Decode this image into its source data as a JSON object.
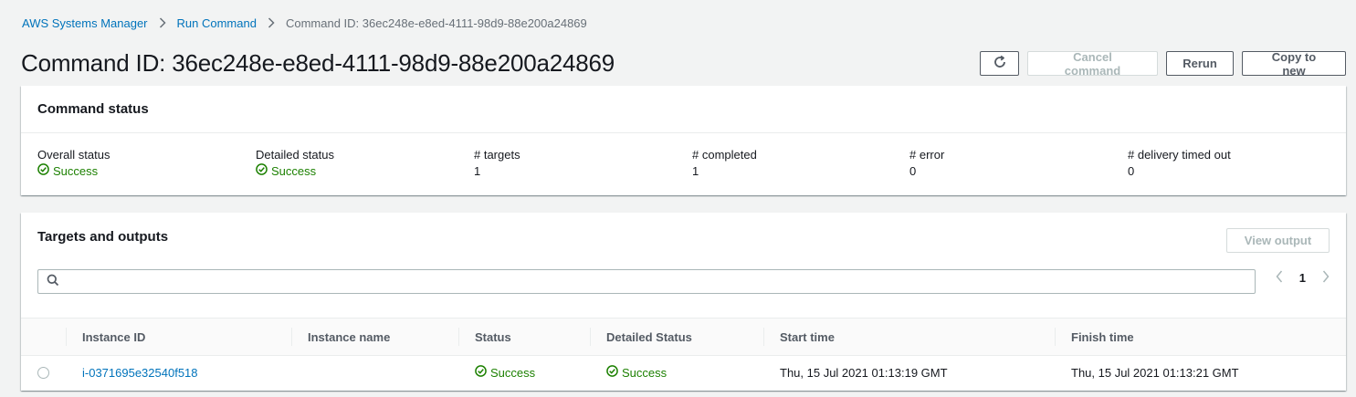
{
  "breadcrumb": {
    "items": [
      "AWS Systems Manager",
      "Run Command"
    ],
    "current": "Command ID: 36ec248e-e8ed-4111-98d9-88e200a24869"
  },
  "page": {
    "title": "Command ID: 36ec248e-e8ed-4111-98d9-88e200a24869"
  },
  "actions": {
    "refresh_icon": "refresh-icon",
    "cancel_label": "Cancel command",
    "rerun_label": "Rerun",
    "copy_label": "Copy to new"
  },
  "command_status": {
    "title": "Command status",
    "fields": [
      {
        "label": "Overall status",
        "value": "Success",
        "status": "success"
      },
      {
        "label": "Detailed status",
        "value": "Success",
        "status": "success"
      },
      {
        "label": "# targets",
        "value": "1"
      },
      {
        "label": "# completed",
        "value": "1"
      },
      {
        "label": "# error",
        "value": "0"
      },
      {
        "label": "# delivery timed out",
        "value": "0"
      }
    ]
  },
  "targets": {
    "title": "Targets and outputs",
    "view_output_label": "View output",
    "search": {
      "value": "",
      "placeholder": ""
    },
    "pager": {
      "page": "1"
    },
    "columns": [
      "Instance ID",
      "Instance name",
      "Status",
      "Detailed Status",
      "Start time",
      "Finish time"
    ],
    "rows": [
      {
        "instance_id": "i-0371695e32540f518",
        "instance_name": "",
        "status": "Success",
        "detailed_status": "Success",
        "start_time": "Thu, 15 Jul 2021 01:13:19 GMT",
        "finish_time": "Thu, 15 Jul 2021 01:13:21 GMT"
      }
    ]
  },
  "colors": {
    "link": "#0073bb",
    "success": "#1d8102",
    "disabled": "#aab7b8"
  }
}
